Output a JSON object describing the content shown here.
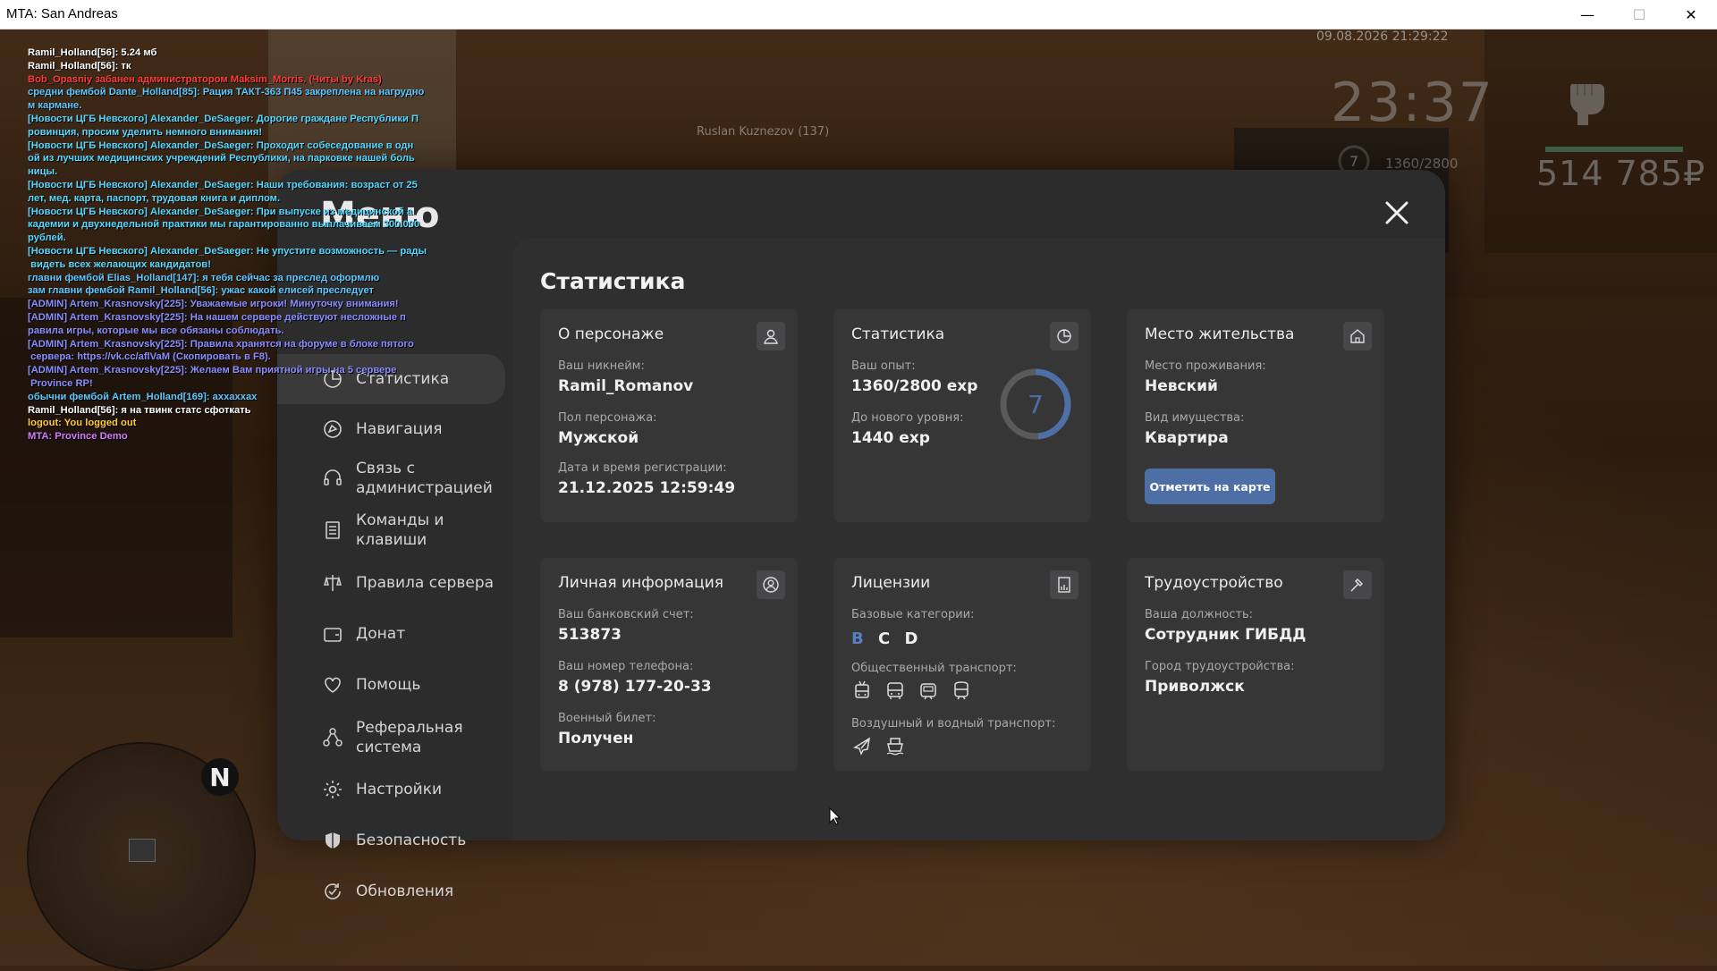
{
  "window": {
    "title": "MTA: San Andreas",
    "minimize": "—",
    "maximize": "☐",
    "close": "✕"
  },
  "hud": {
    "date": "09.08.2026 21:29:22",
    "time": "23:37",
    "level": "7",
    "exp": "1360/2800",
    "money": "514 785₽",
    "nametag": "Ruslan Kuznezov (137)"
  },
  "chat": [
    {
      "text": "Ramil_Holland[56]: 5.24 мб",
      "color": "#ffffff"
    },
    {
      "text": "Ramil_Holland[56]: тк",
      "color": "#ffffff"
    },
    {
      "text": "Bob_Opasniy забанен администратором Maksim_Morris. (Читы by Kras)",
      "color": "#ff3b3b"
    },
    {
      "text": "средни фембой Dante_Holland[85]: Рация ТАКТ-363 П45 закреплена на нагрудно",
      "color": "#5fc8ff"
    },
    {
      "text": "м кармане.",
      "color": "#5fc8ff"
    },
    {
      "text": "[Новости ЦГБ Невского] Alexander_DeSaeger: Дорогие граждане Республики П",
      "color": "#57d8ff"
    },
    {
      "text": "ровинция, просим уделить немного внимания!",
      "color": "#57d8ff"
    },
    {
      "text": "[Новости ЦГБ Невского] Alexander_DeSaeger: Проходит собеседование в одн",
      "color": "#57d8ff"
    },
    {
      "text": "ой из лучших медицинских учреждений Республики, на парковке нашей боль",
      "color": "#57d8ff"
    },
    {
      "text": "ницы.",
      "color": "#57d8ff"
    },
    {
      "text": "[Новости ЦГБ Невского] Alexander_DeSaeger: Наши требования: возраст от 25",
      "color": "#57d8ff"
    },
    {
      "text": "лет, мед. карта, паспорт, трудовая книга и диплом.",
      "color": "#57d8ff"
    },
    {
      "text": "[Новости ЦГБ Невского] Alexander_DeSaeger: При выпуске из медицинской а",
      "color": "#57d8ff"
    },
    {
      "text": "кадемии и двухнедельной практики мы гарантированно выплачиваем 300.000",
      "color": "#57d8ff"
    },
    {
      "text": "рублей.",
      "color": "#57d8ff"
    },
    {
      "text": "[Новости ЦГБ Невского] Alexander_DeSaeger: Не упустите возможность — рады",
      "color": "#57d8ff"
    },
    {
      "text": " видеть всех желающих кандидатов!",
      "color": "#57d8ff"
    },
    {
      "text": "главни фембой Elias_Holland[147]: я тебя сейчас за преслед оформлю",
      "color": "#5fc8ff"
    },
    {
      "text": "зам главни фембой Ramil_Holland[56]: ужас какой елисей преследует",
      "color": "#5fc8ff"
    },
    {
      "text": "[ADMIN] Artem_Krasnovsky[225]: Уважаемые игроки! Минуточку внимания!",
      "color": "#8a8dff"
    },
    {
      "text": "[ADMIN] Artem_Krasnovsky[225]: На нашем сервере действуют несложные п",
      "color": "#8a8dff"
    },
    {
      "text": "равила игры, которые мы все обязаны соблюдать.",
      "color": "#8a8dff"
    },
    {
      "text": "[ADMIN] Artem_Krasnovsky[225]: Правила хранятся на форуме в блоке пятого",
      "color": "#8a8dff"
    },
    {
      "text": " сервера: https://vk.cc/aflVaM (Скопировать в F8).",
      "color": "#8a8dff"
    },
    {
      "text": "[ADMIN] Artem_Krasnovsky[225]: Желаем Вам приятной игры на 5 сервере",
      "color": "#8a8dff"
    },
    {
      "text": " Province RP!",
      "color": "#8a8dff"
    },
    {
      "text": "обычни фембой Artem_Holland[169]: аххаххах",
      "color": "#5fc8ff"
    },
    {
      "text": "Ramil_Holland[56]: я на твинк статс сфоткать",
      "color": "#ffffff"
    },
    {
      "text": "logout: You logged out",
      "color": "#ffcc33"
    },
    {
      "text": "MTA: Province Demo",
      "color": "#d27cff"
    }
  ],
  "minimap": {
    "north": "N"
  },
  "menu": {
    "title": "Меню",
    "sidebar": [
      {
        "label": "Статистика",
        "icon": "stats-icon"
      },
      {
        "label": "Навигация",
        "icon": "navigation-icon"
      },
      {
        "label": "Связь с\nадминистрацией",
        "icon": "support-icon"
      },
      {
        "label": "Команды и\nклавиши",
        "icon": "commands-icon"
      },
      {
        "label": "Правила сервера",
        "icon": "scales-icon"
      },
      {
        "label": "Донат",
        "icon": "wallet-icon"
      },
      {
        "label": "Помощь",
        "icon": "help-icon"
      },
      {
        "label": "Реферальная\nсистема",
        "icon": "referral-icon"
      },
      {
        "label": "Настройки",
        "icon": "gear-icon"
      },
      {
        "label": "Безопасность",
        "icon": "shield-icon"
      },
      {
        "label": "Обновления",
        "icon": "updates-icon"
      }
    ],
    "content_title": "Статистика",
    "character": {
      "title": "О персонаже",
      "nick_label": "Ваш никнейм:",
      "nick": "Ramil_Romanov",
      "gender_label": "Пол персонажа:",
      "gender": "Мужской",
      "reg_label": "Дата и время регистрации:",
      "reg": "21.12.2025 12:59:49"
    },
    "stats": {
      "title": "Статистика",
      "exp_label": "Ваш опыт:",
      "exp": "1360/2800 exp",
      "next_label": "До нового уровня:",
      "next": "1440 exp",
      "level": "7",
      "progress": 0.486
    },
    "residence": {
      "title": "Место жительства",
      "place_label": "Место проживания:",
      "place": "Невский",
      "type_label": "Вид имущества:",
      "type": "Квартира",
      "button": "Отметить на карте"
    },
    "personal": {
      "title": "Личная информация",
      "bank_label": "Ваш банковский счет:",
      "bank": "513873",
      "phone_label": "Ваш номер телефона:",
      "phone": "8 (978) 177-20-33",
      "military_label": "Военный билет:",
      "military": "Получен"
    },
    "licenses": {
      "title": "Лицензии",
      "base_label": "Базовые категории:",
      "categories": [
        "B",
        "C",
        "D"
      ],
      "public_label": "Общественный транспорт:",
      "air_label": "Воздушный и водный транспорт:"
    },
    "employment": {
      "title": "Трудоустройство",
      "position_label": "Ваша должность:",
      "position": "Сотрудник ГИБДД",
      "city_label": "Город трудоустройства:",
      "city": "Приволжск"
    }
  },
  "colors": {
    "accent": "#4d6fa6",
    "modal_bg": "#2c2c2c",
    "card_bg": "#363637",
    "category_b": "#5a7fc0"
  }
}
